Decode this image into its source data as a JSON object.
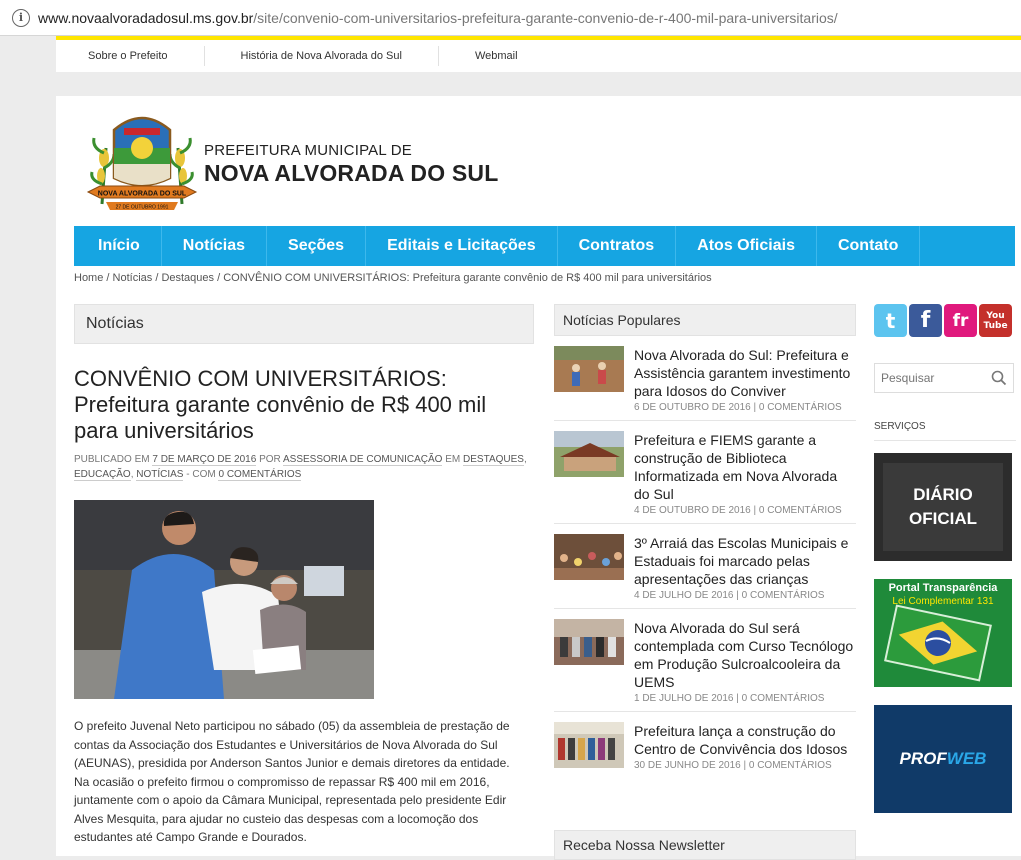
{
  "browser": {
    "url_host": "www.novaalvoradadosul.ms.gov.br",
    "url_path": "/site/convenio-com-universitarios-prefeitura-garante-convenio-de-r-400-mil-para-universitarios/"
  },
  "topbar": {
    "links": [
      "Sobre o Prefeito",
      "História de Nova Alvorada do Sul",
      "Webmail"
    ]
  },
  "header": {
    "title_small": "PREFEITURA MUNICIPAL DE",
    "title_big": "NOVA ALVORADA DO SUL",
    "logo_banner_text": "NOVA ALVORADA DO SUL",
    "logo_date_text": "27 DE OUTUBRO 1991"
  },
  "nav": {
    "items": [
      "Início",
      "Notícias",
      "Seções",
      "Editais e Licitações",
      "Contratos",
      "Atos Oficiais",
      "Contato"
    ]
  },
  "breadcrumb": {
    "home": "Home",
    "sep": " / ",
    "noticias": "Notícias",
    "destaques": "Destaques",
    "current": "CONVÊNIO COM UNIVERSITÁRIOS: Prefeitura garante convênio de R$ 400 mil para universitários"
  },
  "main": {
    "section_title": "Notícias",
    "post_title": "CONVÊNIO COM UNIVERSITÁRIOS: Prefeitura garante convênio de R$ 400 mil para universitários",
    "meta_prefix": "Publicado em ",
    "meta_date": "7 de março de 2016",
    "meta_by": " por ",
    "meta_author": "Assessoria de Comunicação",
    "meta_in": " em ",
    "meta_cat1": "Destaques",
    "meta_cat2": "Educação",
    "meta_cat3": "Notícias",
    "meta_com": " - com ",
    "meta_comments": "0 Comentários",
    "body": "O prefeito Juvenal Neto participou no sábado (05) da assembleia de prestação de contas da Associação dos Estudantes e Universitários de Nova Alvorada do Sul (AEUNAS), presidida por Anderson Santos Junior e demais diretores da entidade. Na ocasião o prefeito firmou o compromisso de repassar R$ 400 mil em 2016, juntamente com o apoio da Câmara Municipal, representada pelo presidente Edir Alves Mesquita, para ajudar no custeio das despesas com a locomoção dos estudantes até Campo Grande e Dourados."
  },
  "popular": {
    "title": "Notícias Populares",
    "items": [
      {
        "title": "Nova Alvorada do Sul: Prefeitura e Assistência garantem investimento para Idosos do Conviver",
        "date": "6 de outubro de 2016 | 0 Comentários"
      },
      {
        "title": "Prefeitura e FIEMS garante a construção de Biblioteca Informatizada em Nova Alvorada do Sul",
        "date": "4 de outubro de 2016 | 0 Comentários"
      },
      {
        "title": "3º Arraiá das Escolas Municipais e Estaduais foi marcado pelas apresentações das crianças",
        "date": "4 de julho de 2016 | 0 Comentários"
      },
      {
        "title": "Nova Alvorada do Sul será contemplada com Curso Tecnólogo em Produção Sulcroalcooleira da UEMS",
        "date": "1 de julho de 2016 | 0 Comentários"
      },
      {
        "title": "Prefeitura lança a construção do Centro de Convivência dos Idosos",
        "date": "30 de junho de 2016 | 0 Comentários"
      }
    ],
    "newsletter": "Receba Nossa Newsletter"
  },
  "sidebar": {
    "social": {
      "twitter": "t",
      "facebook": "f",
      "friendfeed": "fr",
      "youtube_1": "You",
      "youtube_2": "Tube"
    },
    "search_placeholder": "Pesquisar",
    "servicos": "Serviços",
    "diario_1": "DIÁRIO",
    "diario_2": "OFICIAL",
    "transp_1": "Portal Transparência",
    "transp_2": "Lei Complementar 131",
    "prof_1": "PROF",
    "prof_2": "WEB"
  },
  "colors": {
    "nav_blue": "#16a5e2",
    "top_yellow": "#ffe600",
    "transp_green": "#1f8a3a",
    "prof_blue": "#103a68"
  }
}
